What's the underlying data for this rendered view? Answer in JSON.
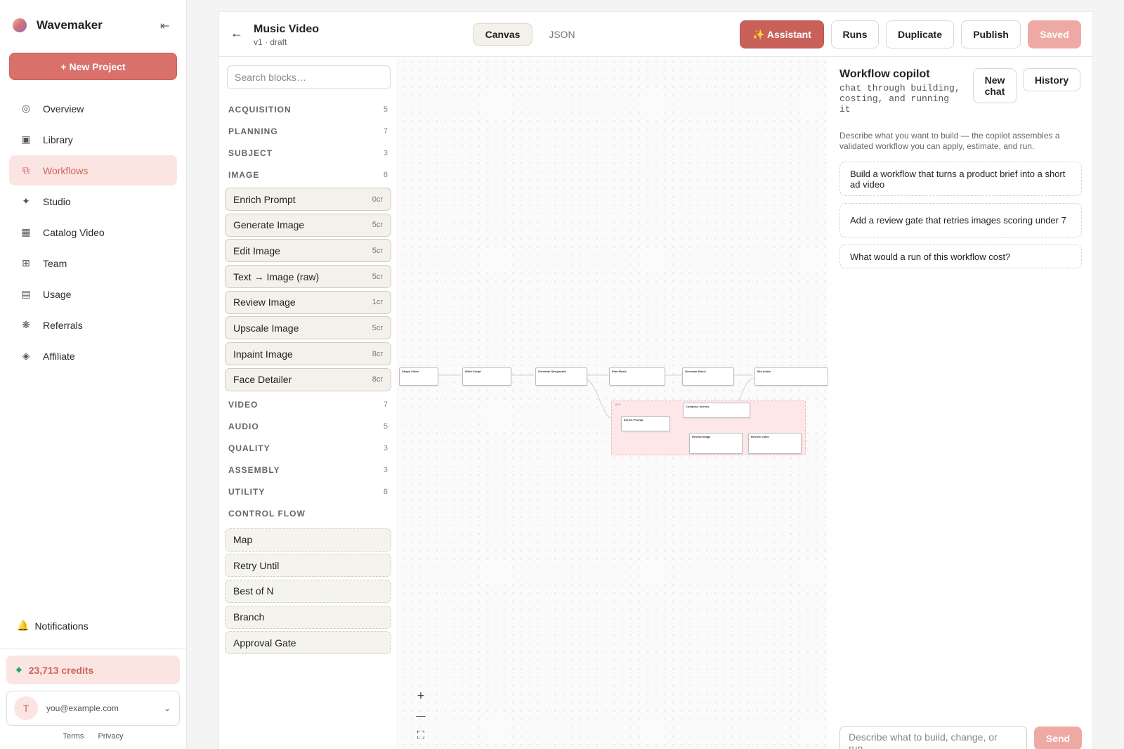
{
  "sidebar": {
    "brand": "Wavemaker",
    "collapse_icon": "collapse-icon",
    "new_project": "+ New Project",
    "items": [
      {
        "label": "Overview",
        "icon": "overview-icon",
        "glyph": "◎"
      },
      {
        "label": "Library",
        "icon": "library-icon",
        "glyph": "▣"
      },
      {
        "label": "Workflows",
        "icon": "workflows-icon",
        "glyph": "⧉",
        "active": true
      },
      {
        "label": "Studio",
        "icon": "studio-icon",
        "glyph": "✦"
      },
      {
        "label": "Catalog Video",
        "icon": "catalog-video-icon",
        "glyph": "▦"
      },
      {
        "label": "Team",
        "icon": "team-icon",
        "glyph": "⊞"
      },
      {
        "label": "Usage",
        "icon": "usage-icon",
        "glyph": "▤"
      },
      {
        "label": "Referrals",
        "icon": "referrals-icon",
        "glyph": "❋"
      },
      {
        "label": "Affiliate",
        "icon": "affiliate-icon",
        "glyph": "◈"
      }
    ],
    "notifications": "Notifications",
    "credits": "23,713 credits",
    "user_initial": "T",
    "user_email": "you@example.com",
    "terms": "Terms",
    "privacy": "Privacy"
  },
  "header": {
    "title": "Music Video",
    "subtitle": "v1 · draft",
    "tabs": [
      "Canvas",
      "JSON"
    ],
    "assistant": "✨ Assistant",
    "runs": "Runs",
    "duplicate": "Duplicate",
    "publish": "Publish",
    "saved": "Saved"
  },
  "blocks": {
    "search_placeholder": "Search blocks…",
    "cats": [
      {
        "name": "ACQUISITION",
        "count": "5"
      },
      {
        "name": "PLANNING",
        "count": "7"
      },
      {
        "name": "SUBJECT",
        "count": "3"
      },
      {
        "name": "IMAGE",
        "count": "8"
      }
    ],
    "image_blocks": [
      {
        "label": "Enrich Prompt",
        "cost": "0cr"
      },
      {
        "label": "Generate Image",
        "cost": "5cr"
      },
      {
        "label": "Edit Image",
        "cost": "5cr"
      },
      {
        "label": "Text → Image (raw)",
        "cost": "5cr"
      },
      {
        "label": "Review Image",
        "cost": "1cr"
      },
      {
        "label": "Upscale Image",
        "cost": "5cr"
      },
      {
        "label": "Inpaint Image",
        "cost": "8cr"
      },
      {
        "label": "Face Detailer",
        "cost": "8cr"
      }
    ],
    "cats2": [
      {
        "name": "VIDEO",
        "count": "7"
      },
      {
        "name": "AUDIO",
        "count": "5"
      },
      {
        "name": "QUALITY",
        "count": "3"
      },
      {
        "name": "ASSEMBLY",
        "count": "3"
      },
      {
        "name": "UTILITY",
        "count": "8"
      }
    ],
    "control_flow": "CONTROL FLOW",
    "control_blocks": [
      "Map",
      "Retry Until",
      "Best of N",
      "Branch",
      "Approval Gate"
    ]
  },
  "canvas": {
    "nodes": [
      "Shape Video",
      "Write Script",
      "Generate Storyboard",
      "Plan Music",
      "Generate Music",
      "Mix Audio",
      "Compose Scenes",
      "Enrich Prompt",
      "Review Image",
      "Review Video"
    ],
    "group_label": "MAP",
    "zoom_in": "+",
    "zoom_out": "—",
    "fit": "⛶"
  },
  "copilot": {
    "title": "Workflow copilot",
    "subtitle": "chat through building, costing, and running it",
    "new_chat": "New chat",
    "history": "History",
    "description": "Describe what you want to build — the copilot assembles a validated workflow you can apply, estimate, and run.",
    "suggestions": [
      "Build a workflow that turns a product brief into a short ad video",
      "Add a review gate that retries images scoring under 7",
      "What would a run of this workflow cost?"
    ],
    "input_placeholder": "Describe what to build, change, or run…",
    "send": "Send"
  },
  "colors": {
    "accent": "#d9716a",
    "accent_light": "#fbe5e2",
    "saved": "#eea9a5",
    "credits_dot": "#29a36a"
  }
}
